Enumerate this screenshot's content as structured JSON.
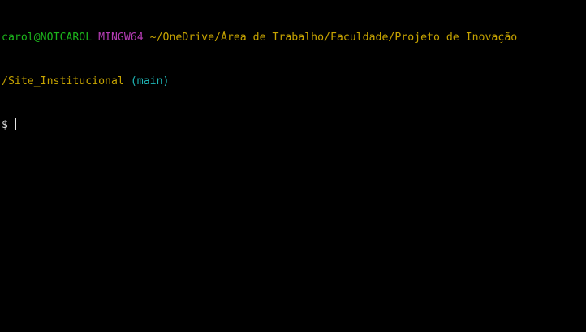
{
  "terminal": {
    "user_host": "carol@NOTCAROL",
    "system": "MINGW64",
    "path_line1": "~/OneDrive/Área de Trabalho/Faculdade/Projeto de Inovação",
    "path_line2": "/Site_Institucional",
    "branch": "(main)",
    "prompt": "$",
    "input_value": "",
    "colors": {
      "background": "#000000",
      "user_host": "#1cb41c",
      "system": "#b43cb4",
      "path": "#c7a400",
      "branch": "#1fb7b7",
      "prompt": "#d8d8d8"
    }
  }
}
